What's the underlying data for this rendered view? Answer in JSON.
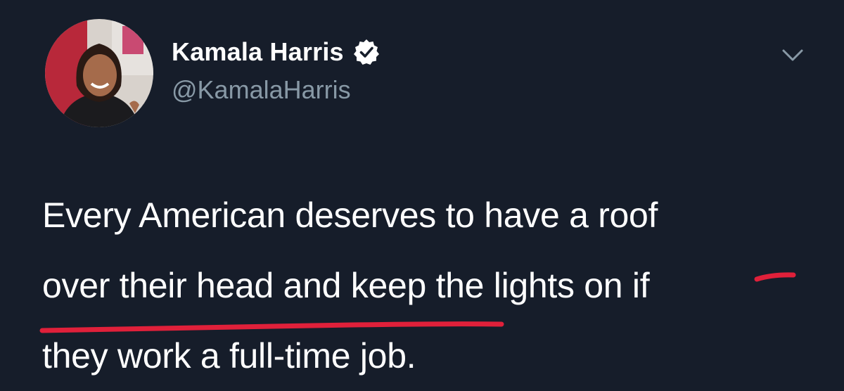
{
  "tweet": {
    "author": {
      "name": "Kamala Harris",
      "handle": "@KamalaHarris",
      "verified": true,
      "avatar_icon": "profile-photo"
    },
    "menu_icon": "chevron-down-icon",
    "lines": [
      "Every American deserves to have a roof",
      "over their head and keep the lights on",
      "job."
    ],
    "struck_text": {
      "line2": "if",
      "line3": "they work a full-time"
    }
  },
  "colors": {
    "background": "#161d2a",
    "text": "#ffffff",
    "secondary_text": "#8899a6",
    "strike": "#e0203a"
  }
}
